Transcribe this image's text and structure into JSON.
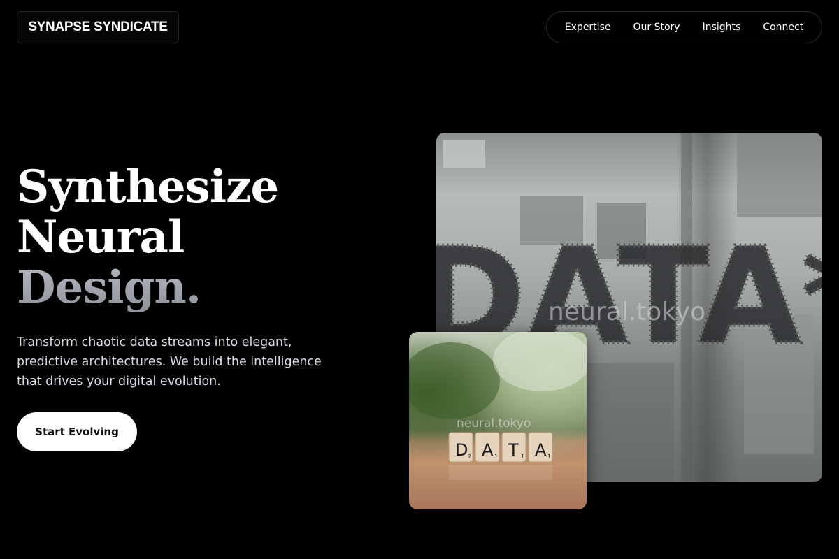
{
  "header": {
    "brand": "SYNAPSE SYNDICATE",
    "nav": [
      {
        "label": "Expertise"
      },
      {
        "label": "Our Story"
      },
      {
        "label": "Insights"
      },
      {
        "label": "Connect"
      }
    ]
  },
  "hero": {
    "headline": {
      "line1": "Synthesize",
      "line2": "Neural",
      "line3": "Design."
    },
    "subcopy": "Transform chaotic data streams into elegant, predictive architectures. We build the intelligence that drives your digital evolution.",
    "cta_label": "Start Evolving"
  },
  "images": {
    "large": {
      "window_text": "DATA*",
      "watermark": "neural.tokyo"
    },
    "small": {
      "tiles": [
        {
          "letter": "D",
          "score": "2"
        },
        {
          "letter": "A",
          "score": "1"
        },
        {
          "letter": "T",
          "score": "1"
        },
        {
          "letter": "A",
          "score": "1"
        }
      ],
      "watermark": "neural.tokyo"
    }
  },
  "colors": {
    "background": "#000000",
    "text": "#ffffff",
    "muted_headline": "#9a9ea6",
    "cta_bg": "#ffffff",
    "cta_text": "#111111"
  }
}
